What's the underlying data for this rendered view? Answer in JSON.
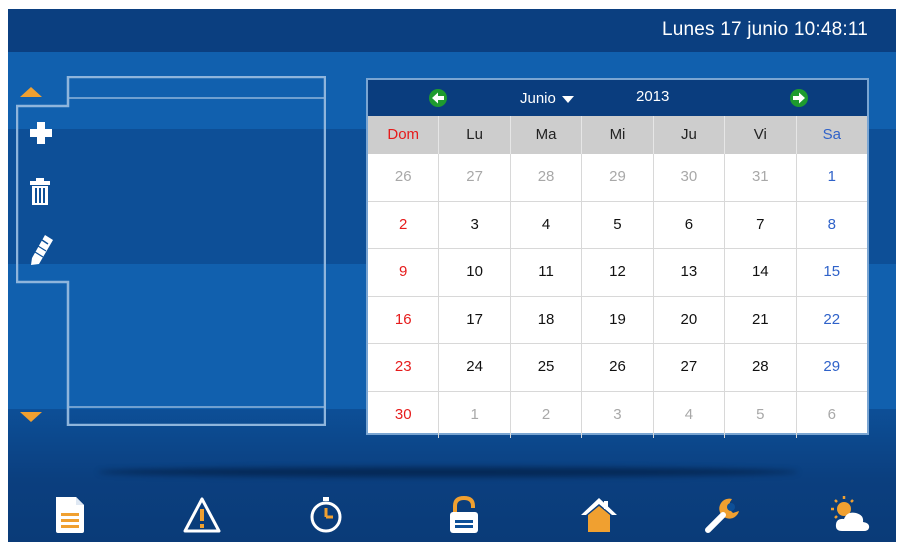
{
  "header": {
    "datetime": "Lunes 17 junio  10:48:11"
  },
  "left_panel": {
    "tools": [
      "add-icon",
      "trash-icon",
      "pencil-icon"
    ],
    "scroll_up_icon": "triangle-up-icon",
    "scroll_down_icon": "triangle-down-icon",
    "accent_color": "#f0a030",
    "border_color": "#8fb5dc"
  },
  "calendar": {
    "month": "Junio",
    "year": "2013",
    "prev_icon": "arrow-left-icon",
    "next_icon": "arrow-right-icon",
    "weekdays": [
      "Dom",
      "Lu",
      "Ma",
      "Mi",
      "Ju",
      "Vi",
      "Sa"
    ],
    "weeks": [
      [
        "26",
        "27",
        "28",
        "29",
        "30",
        "31",
        "1"
      ],
      [
        "2",
        "3",
        "4",
        "5",
        "6",
        "7",
        "8"
      ],
      [
        "9",
        "10",
        "11",
        "12",
        "13",
        "14",
        "15"
      ],
      [
        "16",
        "17",
        "18",
        "19",
        "20",
        "21",
        "22"
      ],
      [
        "23",
        "24",
        "25",
        "26",
        "27",
        "28",
        "29"
      ],
      [
        "30",
        "1",
        "2",
        "3",
        "4",
        "5",
        "6"
      ]
    ],
    "other_month_cells": [
      [
        0,
        0
      ],
      [
        0,
        1
      ],
      [
        0,
        2
      ],
      [
        0,
        3
      ],
      [
        0,
        4
      ],
      [
        0,
        5
      ],
      [
        5,
        1
      ],
      [
        5,
        2
      ],
      [
        5,
        3
      ],
      [
        5,
        4
      ],
      [
        5,
        5
      ],
      [
        5,
        6
      ]
    ],
    "colors": {
      "sunday": "#e61b1b",
      "saturday": "#2f62c9",
      "other_month": "#a8a8a8",
      "nav_button": "#1e9b2f"
    }
  },
  "nav_bar": {
    "items": [
      "document-icon",
      "warning-icon",
      "timer-icon",
      "unlock-icon",
      "home-icon",
      "wrench-icon",
      "weather-icon"
    ],
    "icon_color": "#ffffff",
    "accent_color": "#f0a030"
  }
}
